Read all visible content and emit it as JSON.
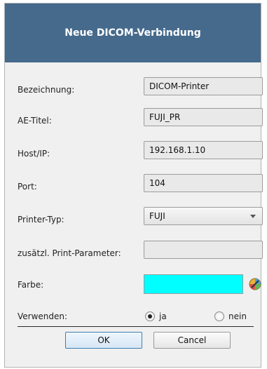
{
  "dialog": {
    "title": "Neue DICOM-Verbindung",
    "fields": {
      "bezeichnung": {
        "label": "Bezeichnung:",
        "value": "DICOM-Printer"
      },
      "ae_titel": {
        "label": "AE-Titel:",
        "value": "FUJI_PR"
      },
      "host": {
        "label": "Host/IP:",
        "value": "192.168.1.10"
      },
      "port": {
        "label": "Port:",
        "value": "104"
      },
      "printer_typ": {
        "label": "Printer-Typ:",
        "value": "FUJI"
      },
      "print_params": {
        "label": "zusätzl. Print-Parameter:",
        "value": ""
      },
      "farbe": {
        "label": "Farbe:",
        "color": "#00ffff",
        "picker_icon": "color-picker-icon"
      },
      "verwenden": {
        "label": "Verwenden:",
        "options": [
          "ja",
          "nein"
        ],
        "selected": "ja"
      }
    },
    "buttons": {
      "ok": "OK",
      "cancel": "Cancel"
    },
    "colors": {
      "header": "#456a8c",
      "background": "#f0f0f0"
    }
  }
}
